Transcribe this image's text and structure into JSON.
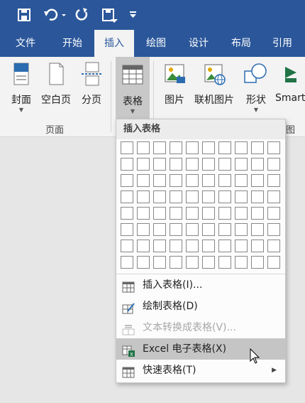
{
  "quick_access": {
    "icons": [
      "save-icon",
      "undo-icon",
      "redo-icon",
      "touch-mode-icon",
      "customize-icon"
    ]
  },
  "tabs": [
    {
      "label": "文件",
      "active": false
    },
    {
      "label": "开始",
      "active": false
    },
    {
      "label": "插入",
      "active": true
    },
    {
      "label": "绘图",
      "active": false
    },
    {
      "label": "设计",
      "active": false
    },
    {
      "label": "布局",
      "active": false
    },
    {
      "label": "引用",
      "active": false
    }
  ],
  "ribbon": {
    "pages_group": {
      "label": "页面",
      "buttons": [
        {
          "label": "封面",
          "icon": "cover-page-icon",
          "has_dropdown": true
        },
        {
          "label": "空白页",
          "icon": "blank-page-icon",
          "has_dropdown": false
        },
        {
          "label": "分页",
          "icon": "page-break-icon",
          "has_dropdown": false
        }
      ]
    },
    "table_button": {
      "label": "表格",
      "icon": "table-icon",
      "has_dropdown": true
    },
    "illustrations_group": {
      "label_fragment": "图",
      "buttons": [
        {
          "label": "图片",
          "icon": "picture-icon",
          "has_dropdown": false
        },
        {
          "label": "联机图片",
          "icon": "online-picture-icon",
          "has_dropdown": false
        },
        {
          "label": "形状",
          "icon": "shapes-icon",
          "has_dropdown": true
        },
        {
          "label": "Smart",
          "icon": "smartart-icon",
          "has_dropdown": false
        }
      ]
    }
  },
  "table_menu": {
    "header": "插入表格",
    "grid": {
      "columns": 10,
      "rows": 8
    },
    "items": [
      {
        "label": "插入表格(I)...",
        "icon": "insert-table-icon",
        "disabled": false,
        "hover": false,
        "submenu": false
      },
      {
        "label": "绘制表格(D)",
        "icon": "draw-table-icon",
        "disabled": false,
        "hover": false,
        "submenu": false
      },
      {
        "label": "文本转换成表格(V)...",
        "icon": "text-to-table-icon",
        "disabled": true,
        "hover": false,
        "submenu": false
      },
      {
        "label": "Excel 电子表格(X)",
        "icon": "excel-table-icon",
        "disabled": false,
        "hover": true,
        "submenu": false
      },
      {
        "label": "快速表格(T)",
        "icon": "quick-tables-icon",
        "disabled": false,
        "hover": false,
        "submenu": true
      }
    ]
  },
  "colors": {
    "ribbon_blue": "#2b579a",
    "excel_green": "#217346"
  }
}
